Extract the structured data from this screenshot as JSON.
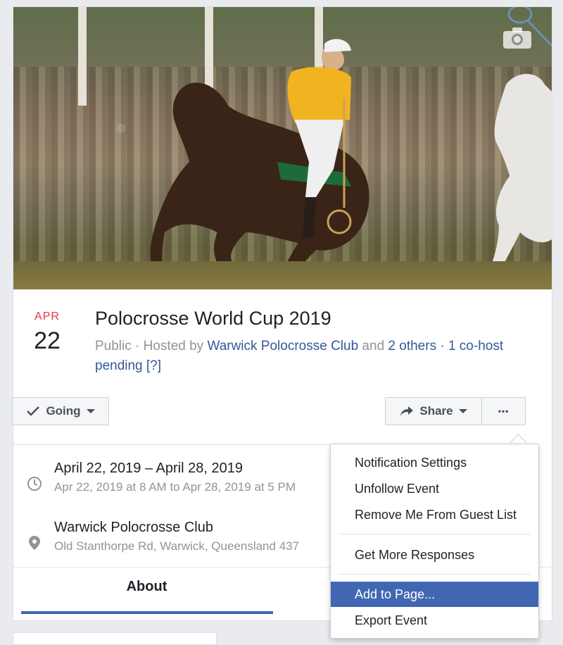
{
  "event": {
    "month": "APR",
    "day": "22",
    "title": "Polocrosse World Cup 2019",
    "subtitle_prefix": "Public · Hosted by ",
    "host_link": "Warwick Polocrosse Club",
    "and_text": " and ",
    "others_link": "2 others",
    "cohost_link": " · 1 co-host pending [?]"
  },
  "actions": {
    "going_label": "Going",
    "share_label": "Share",
    "more_label": "•••"
  },
  "details": {
    "date_main": "April 22, 2019 – April 28, 2019",
    "date_sub": "Apr 22, 2019 at 8 AM to Apr 28, 2019 at 5 PM",
    "location_main": "Warwick Polocrosse Club",
    "location_sub": "Old Stanthorpe Rd, Warwick, Queensland 437"
  },
  "tabs": {
    "about_label": "About"
  },
  "menu": {
    "items": [
      "Notification Settings",
      "Unfollow Event",
      "Remove Me From Guest List",
      "Get More Responses",
      "Add to Page...",
      "Export Event"
    ],
    "active_index": 4
  },
  "colors": {
    "link": "#365899",
    "month": "#e0393e",
    "accent": "#4267b2"
  },
  "icons": {
    "cover": "camera-icon",
    "going": "checkmark-icon",
    "share": "share-arrow-icon",
    "date": "clock-icon",
    "location": "map-pin-icon"
  }
}
